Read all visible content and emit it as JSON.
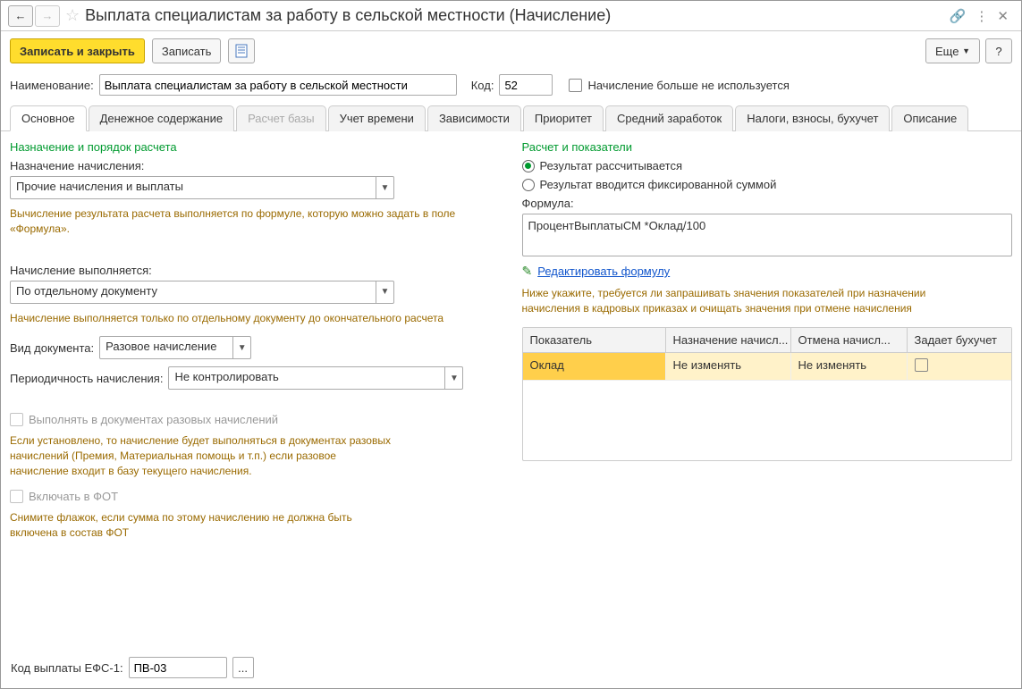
{
  "title": "Выплата специалистам за работу в сельской местности (Начисление)",
  "toolbar": {
    "save_close": "Записать и закрыть",
    "save": "Записать",
    "more": "Еще"
  },
  "header": {
    "name_label": "Наименование:",
    "name_value": "Выплата специалистам за работу в сельской местности",
    "code_label": "Код:",
    "code_value": "52",
    "unused_label": "Начисление больше не используется"
  },
  "tabs": {
    "t0": "Основное",
    "t1": "Денежное содержание",
    "t2": "Расчет базы",
    "t3": "Учет времени",
    "t4": "Зависимости",
    "t5": "Приоритет",
    "t6": "Средний заработок",
    "t7": "Налоги, взносы, бухучет",
    "t8": "Описание"
  },
  "left": {
    "section1": "Назначение и порядок расчета",
    "assign_label": "Назначение начисления:",
    "assign_value": "Прочие начисления и выплаты",
    "assign_hint": "Вычисление результата расчета выполняется по формуле, которую можно задать в поле «Формула».",
    "exec_label": "Начисление выполняется:",
    "exec_value": "По отдельному документу",
    "exec_hint": "Начисление выполняется только по отдельному документу до окончательного расчета",
    "doc_label": "Вид документа:",
    "doc_value": "Разовое начисление",
    "period_label": "Периодичность начисления:",
    "period_value": "Не контролировать",
    "cb1_label": "Выполнять в документах разовых начислений",
    "cb1_hint": "Если установлено, то начисление будет выполняться в документах разовых начислений (Премия, Материальная помощь и т.п.) если разовое начисление входит в базу текущего начисления.",
    "cb2_label": "Включать в ФОТ",
    "cb2_hint": "Снимите флажок, если сумма по этому начислению не должна быть включена в состав ФОТ"
  },
  "right": {
    "section": "Расчет и показатели",
    "radio1": "Результат рассчитывается",
    "radio2": "Результат вводится фиксированной суммой",
    "formula_label": "Формула:",
    "formula_value": "ПроцентВыплатыСМ *Оклад/100",
    "edit_link": "Редактировать формулу",
    "grid_hint": "Ниже укажите, требуется ли запрашивать значения показателей при назначении начисления в кадровых приказах и очищать значения при отмене начисления",
    "grid": {
      "h1": "Показатель",
      "h2": "Назначение начисл...",
      "h3": "Отмена начисл...",
      "h4": "Задает бухучет",
      "rows": [
        {
          "c1": "Оклад",
          "c2": "Не изменять",
          "c3": "Не изменять"
        }
      ]
    }
  },
  "footer": {
    "efs_label": "Код выплаты ЕФС-1:",
    "efs_value": "ПВ-03"
  }
}
